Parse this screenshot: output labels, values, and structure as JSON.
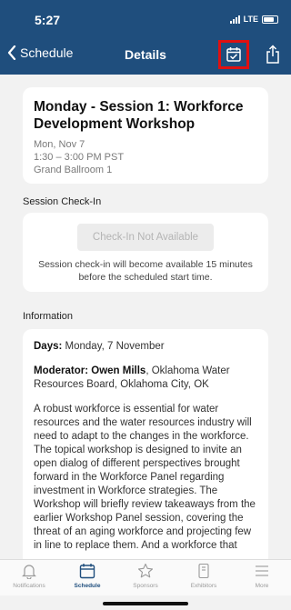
{
  "status_bar": {
    "time": "5:27",
    "network": "LTE"
  },
  "nav": {
    "back_label": "Schedule",
    "title": "Details"
  },
  "session": {
    "title": "Monday - Session 1: Workforce Development Workshop",
    "date": "Mon, Nov 7",
    "time": "1:30 – 3:00 PM PST",
    "location": "Grand Ballroom 1"
  },
  "checkin": {
    "section_label": "Session Check-In",
    "button_label": "Check-In Not Available",
    "note": "Session check-in will become available 15 minutes before the scheduled start time."
  },
  "information": {
    "section_label": "Information",
    "days_label": "Days:",
    "days_value": "Monday, 7 November",
    "moderator_label": "Moderator:",
    "moderator_name": "Owen Mills",
    "moderator_org": ", Oklahoma Water Resources Board, Oklahoma City, OK",
    "description": "A robust workforce is essential for water resources and the water resources industry will need to adapt to the changes in the workforce. The topical workshop is designed to invite an open dialog of different perspectives brought forward in the Workforce Panel regarding investment in Workforce strategies. The Workshop will briefly review takeaways from the earlier Workshop Panel session, covering the threat of an aging workforce and projecting few in line to replace them. And a workforce that"
  },
  "tabs": [
    {
      "label": "Notifications",
      "icon": "bell-icon"
    },
    {
      "label": "Schedule",
      "icon": "calendar-icon",
      "active": true
    },
    {
      "label": "Sponsors",
      "icon": "star-icon"
    },
    {
      "label": "Exhibitors",
      "icon": "badge-icon"
    },
    {
      "label": "More",
      "icon": "menu-icon"
    }
  ],
  "colors": {
    "header": "#1f4e7d",
    "highlight": "#e01010",
    "active_tab": "#1f4e7d"
  }
}
